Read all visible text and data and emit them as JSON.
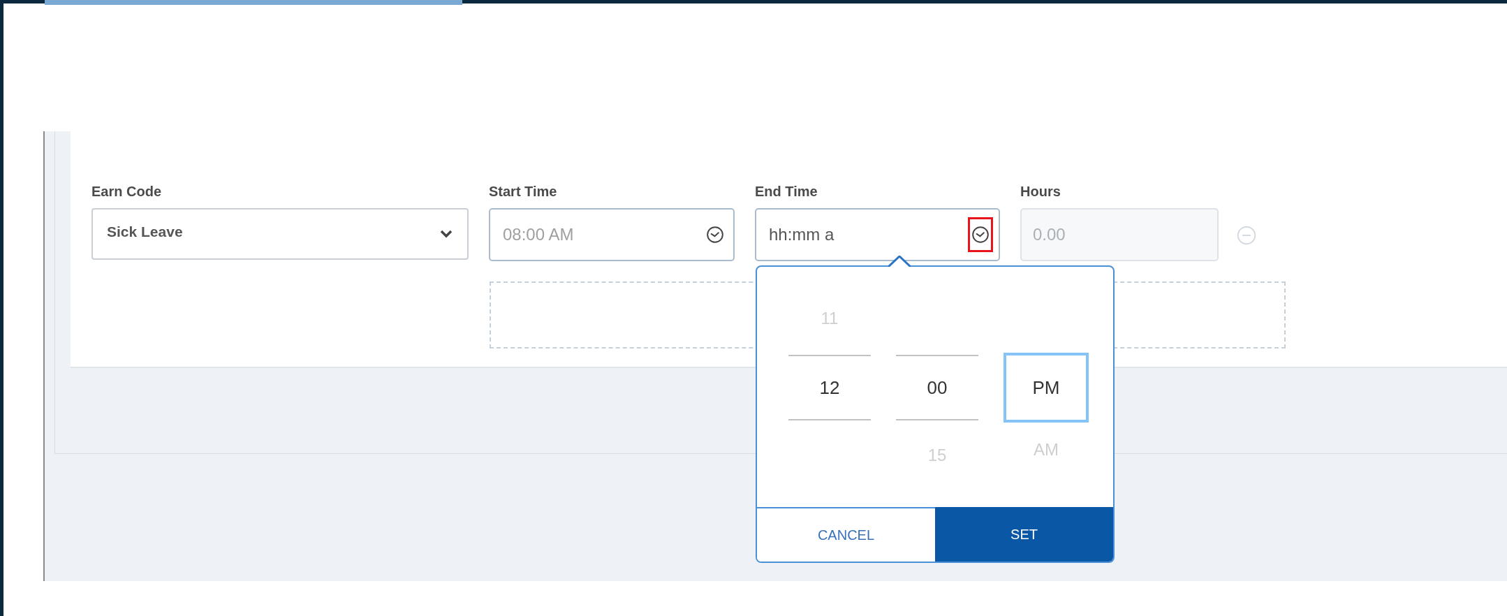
{
  "form": {
    "fields": [
      {
        "kind": "select",
        "label": "Earn Code",
        "value": "Sick Leave"
      },
      {
        "kind": "time",
        "label": "Start Time",
        "value": "08:00 AM",
        "icon_highlighted": false,
        "picker_open": false
      },
      {
        "kind": "time",
        "label": "End Time",
        "placeholder": "hh:mm a",
        "icon_highlighted": true,
        "picker_open": true
      },
      {
        "kind": "number",
        "label": "Hours",
        "value": "0.00",
        "disabled": true
      }
    ],
    "remove_row": {
      "disabled": true
    }
  },
  "time_picker": {
    "columns": [
      {
        "kind": "hour",
        "items": [
          {
            "value": "11",
            "selected": false
          },
          {
            "value": "12",
            "selected": true
          }
        ]
      },
      {
        "kind": "minute",
        "items": [
          {
            "value": "00",
            "selected": true
          },
          {
            "value": "15",
            "selected": false
          }
        ]
      },
      {
        "kind": "period",
        "items": [
          {
            "value": "PM",
            "selected": true
          },
          {
            "value": "AM",
            "selected": false
          }
        ]
      }
    ],
    "buttons": [
      {
        "label": "CANCEL",
        "kind": "secondary"
      },
      {
        "label": "SET",
        "kind": "primary"
      }
    ]
  }
}
